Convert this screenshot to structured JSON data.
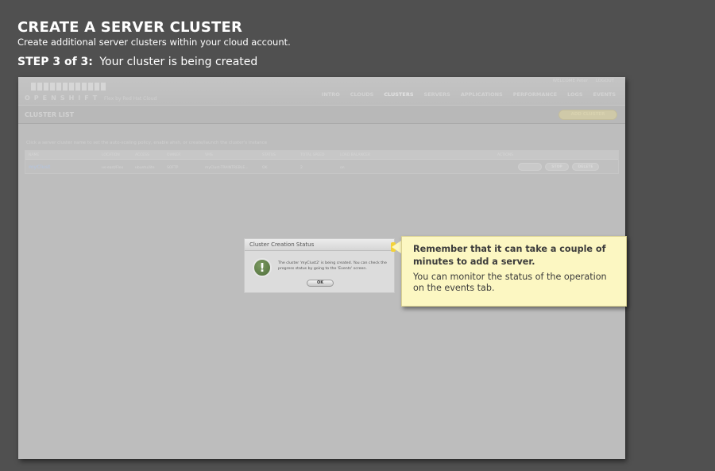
{
  "tutorial": {
    "title": "CREATE A SERVER CLUSTER",
    "subtitle": "Create additional server clusters within your cloud account.",
    "step_label": "STEP 3 of 3:",
    "step_text": "Your cluster is being created"
  },
  "app": {
    "logo_text": "OPENSHIFT",
    "tagline": "Flex by Red Hat Cloud",
    "user_label": "WELCOME Peter",
    "logout_label": "LOGOUT",
    "nav": [
      "INTRO",
      "CLOUDS",
      "CLUSTERS",
      "SERVERS",
      "APPLICATIONS",
      "PERFORMANCE",
      "LOGS",
      "EVENTS"
    ],
    "active_nav": "CLUSTERS",
    "page_title": "CLUSTER LIST",
    "add_button": "ADD CLUSTER",
    "instructions": "Click a server cluster name to set the auto-scaling policy, enable ahsh, or create/launch the cluster's instance",
    "table": {
      "headers": [
        "NAME",
        "LOCATION",
        "ACCESS",
        "OWNER",
        "VMS",
        "STATUS",
        "TOTAL SPEED",
        "LOAD BALANCER",
        "ACTIONS"
      ],
      "rows": [
        {
          "name": "myClust",
          "location": "us-east/Flex",
          "access": "ubuntu/lite",
          "owner": "SOFTP",
          "vms": "myClust-TRAINTREBLE...",
          "status": "OK",
          "total_speed": "2",
          "load_balancer": "on",
          "actions": [
            "",
            "STOP",
            "DELETE"
          ]
        }
      ]
    }
  },
  "dialog": {
    "title": "Cluster Creation Status",
    "icon": "exclamation-icon",
    "message": "The cluster 'myClust2' is being created. You can check the progress status by going to the 'Events' screen.",
    "ok_label": "OK"
  },
  "callout": {
    "heading": "Remember that it can take a couple of minutes to add a server.",
    "body": "You can monitor the status of the operation on the events tab."
  }
}
